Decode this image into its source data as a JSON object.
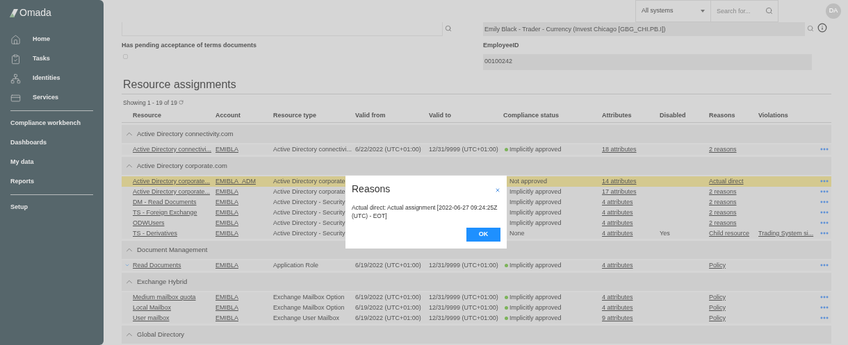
{
  "brand": "Omada",
  "sidebar": [
    {
      "kind": "icon",
      "label": "Home"
    },
    {
      "kind": "icon",
      "label": "Tasks"
    },
    {
      "kind": "icon",
      "label": "Identities"
    },
    {
      "kind": "icon",
      "label": "Services"
    },
    {
      "kind": "divider"
    },
    {
      "kind": "text",
      "label": "Compliance workbench"
    },
    {
      "kind": "text",
      "label": "Dashboards"
    },
    {
      "kind": "text",
      "label": "My data"
    },
    {
      "kind": "text",
      "label": "Reports"
    },
    {
      "kind": "divider"
    },
    {
      "kind": "text",
      "label": "Setup"
    }
  ],
  "topbar": {
    "system_select": "All systems",
    "search_placeholder": "Search for...",
    "avatar": "DA"
  },
  "form": {
    "manager_value": "Emily Black - Trader - Currency (Invest Chicago [GBG_CHI.PB.I])",
    "pending_terms": {
      "label": "Has pending acceptance of terms documents",
      "checked": false
    },
    "employee_id": {
      "label": "EmployeeID",
      "value": "00100242"
    }
  },
  "section": {
    "title": "Resource assignments",
    "showing": "Showing 1 - 19 of 19"
  },
  "table": {
    "columns": [
      "Resource",
      "Account",
      "Resource type",
      "Valid from",
      "Valid to",
      "Compliance status",
      "Attributes",
      "Disabled",
      "Reasons",
      "Violations"
    ],
    "groups": [
      {
        "name": "Active Directory connectivity.com",
        "expanded": true,
        "rows": [
          {
            "resource": "Active Directory connectivi...",
            "account": "EMIBLA",
            "resource_type": "Active Directory connectivi...",
            "valid_from": "6/22/2022 (UTC+01:00)",
            "valid_to": "12/31/9999 (UTC+01:00)",
            "compliance": "Implicitly approved",
            "color": "#7cb35a",
            "attributes": "18 attributes",
            "reasons": "2 reasons",
            "highlighted": false,
            "expandable": false
          }
        ]
      },
      {
        "name": "Active Directory corporate.com",
        "expanded": true,
        "rows": [
          {
            "resource": "Active Directory corporate...",
            "account": "EMIBLA_ADM",
            "resource_type": "Active Directory corporate",
            "compliance": "Not approved",
            "attributes": "14 attributes",
            "reasons": "Actual direct",
            "highlighted": true,
            "expandable": false
          },
          {
            "resource": "Active Directory corporate...",
            "account": "EMIBLA",
            "resource_type": "Active Directory corporate",
            "compliance": "Implicitly approved",
            "attributes": "17 attributes",
            "reasons": "2 reasons",
            "highlighted": false,
            "expandable": false
          },
          {
            "resource": "DM - Read Documents",
            "account": "EMIBLA",
            "resource_type": "Active Directory - Security",
            "compliance": "Implicitly approved",
            "attributes": "4 attributes",
            "reasons": "2 reasons",
            "highlighted": false,
            "expandable": false
          },
          {
            "resource": "TS - Foreign Exchange",
            "account": "EMIBLA",
            "resource_type": "Active Directory - Security",
            "compliance": "Implicitly approved",
            "attributes": "4 attributes",
            "reasons": "2 reasons",
            "highlighted": false,
            "expandable": false
          },
          {
            "resource": "ODWUsers",
            "account": "EMIBLA",
            "resource_type": "Active Directory - Security",
            "compliance": "Implicitly approved",
            "attributes": "4 attributes",
            "reasons": "2 reasons",
            "highlighted": false,
            "expandable": false
          },
          {
            "resource": "TS - Derivatives",
            "account": "EMIBLA",
            "resource_type": "Active Directory - Security",
            "compliance": "None",
            "attributes": "4 attributes",
            "disabled": "Yes",
            "reasons": "Child resource",
            "violations": "Trading System si...",
            "highlighted": false,
            "expandable": false
          }
        ]
      },
      {
        "name": "Document Management",
        "expanded": true,
        "rows": [
          {
            "resource": "Read Documents",
            "account": "EMIBLA",
            "resource_type": "Application Role",
            "valid_from": "6/19/2022 (UTC+01:00)",
            "valid_to": "12/31/9999 (UTC+01:00)",
            "compliance": "Implicitly approved",
            "color": "#7cb35a",
            "attributes": "4 attributes",
            "reasons": "Policy",
            "highlighted": false,
            "expandable": true
          }
        ]
      },
      {
        "name": "Exchange Hybrid",
        "expanded": true,
        "rows": [
          {
            "resource": "Medium mailbox quota",
            "account": "EMIBLA",
            "resource_type": "Exchange Mailbox Option",
            "valid_from": "6/19/2022 (UTC+01:00)",
            "valid_to": "12/31/9999 (UTC+01:00)",
            "compliance": "Implicitly approved",
            "color": "#7cb35a",
            "attributes": "4 attributes",
            "reasons": "Policy",
            "highlighted": false,
            "expandable": false
          },
          {
            "resource": "Local Mailbox",
            "account": "EMIBLA",
            "resource_type": "Exchange Mailbox Option",
            "valid_from": "6/19/2022 (UTC+01:00)",
            "valid_to": "12/31/9999 (UTC+01:00)",
            "compliance": "Implicitly approved",
            "color": "#7cb35a",
            "attributes": "4 attributes",
            "reasons": "Policy",
            "highlighted": false,
            "expandable": false
          },
          {
            "resource": "User mailbox",
            "account": "EMIBLA",
            "resource_type": "Exchange User Mailbox",
            "valid_from": "6/19/2022 (UTC+01:00)",
            "valid_to": "12/31/9999 (UTC+01:00)",
            "compliance": "Implicitly approved",
            "color": "#7cb35a",
            "attributes": "9 attributes",
            "reasons": "Policy",
            "highlighted": false,
            "expandable": false
          }
        ]
      },
      {
        "name": "Global Directory",
        "expanded": true
      }
    ]
  },
  "modal": {
    "title": "Reasons",
    "text": "Actual direct: Actual assignment [2022-06-27 09:24:25Z (UTC) - EOT]",
    "ok": "OK"
  }
}
